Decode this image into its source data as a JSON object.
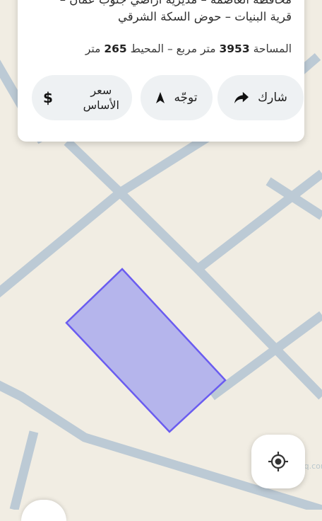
{
  "card": {
    "address_lines": [
      "محافظة العاصمة – مديرية أراضي جنوب عمان –",
      "قرية البنيات – حوض السكة الشرقي"
    ],
    "area_label": "المساحة",
    "area_value": "3953",
    "area_unit": "متر مربع –",
    "perimeter_label": "المحيط",
    "perimeter_value": "265",
    "perimeter_unit": "متر"
  },
  "actions": {
    "share_label": "شارك",
    "directions_label": "توجّه",
    "price_line1": "سعر",
    "price_line2": "الأساس",
    "price_symbol": "$"
  },
  "watermark": {
    "text": "السوق المفتوح",
    "subtext": "opensooq.com"
  },
  "map": {
    "parcel_fill": "#b5b5ec",
    "parcel_stroke": "#6a5cf0",
    "road_color": "#bccad5",
    "background": "#f1ede3"
  },
  "icons": {
    "share": "share-arrow-icon",
    "directions": "navigation-arrow-icon",
    "price": "dollar-icon",
    "locate": "my-location-icon"
  }
}
